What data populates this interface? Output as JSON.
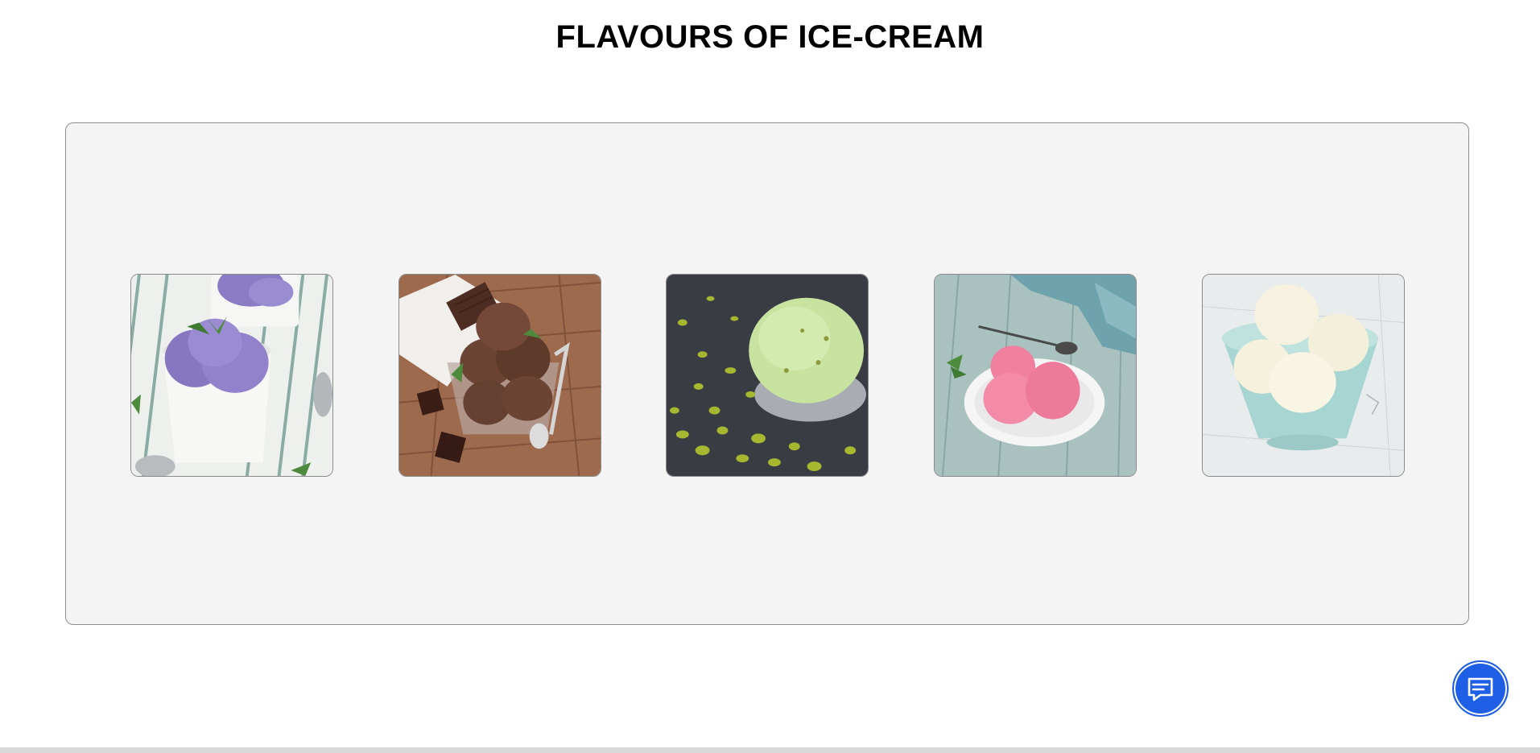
{
  "header": {
    "title": "FLAVOURS OF ICE-CREAM"
  },
  "gallery": {
    "items": [
      {
        "icon": "blueberry-ice-cream-image",
        "scoop_color": "#8a7bc4",
        "bg_color": "#eef0ee"
      },
      {
        "icon": "chocolate-ice-cream-image",
        "scoop_color": "#6b4434",
        "bg_color": "#9e6a4e"
      },
      {
        "icon": "pistachio-ice-cream-image",
        "scoop_color": "#c8e3a0",
        "bg_color": "#3a3c44"
      },
      {
        "icon": "strawberry-ice-cream-image",
        "scoop_color": "#f0809e",
        "bg_color": "#a9c2c0"
      },
      {
        "icon": "vanilla-ice-cream-image",
        "scoop_color": "#f7f2df",
        "bg_color": "#e8ecec"
      }
    ]
  },
  "chat": {
    "icon": "chat-icon",
    "color": "#1e5fe6"
  }
}
